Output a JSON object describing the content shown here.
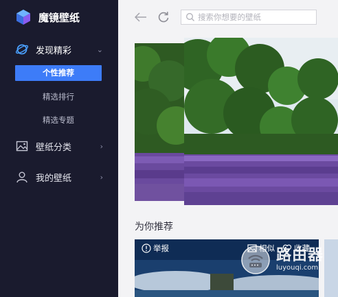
{
  "app": {
    "title": "魔镜壁纸",
    "accent": "#3d7cf8",
    "sidebar_bg": "#1a1b2e"
  },
  "sidebar": {
    "discover": {
      "label": "发现精彩",
      "icon": "planet-icon"
    },
    "sub_items": [
      "个性推荐",
      "精选排行",
      "精选专题"
    ],
    "categories": {
      "label": "壁纸分类",
      "icon": "picture-icon"
    },
    "mine": {
      "label": "我的壁纸",
      "icon": "user-icon"
    }
  },
  "toolbar": {
    "search_placeholder": "搜索你想要的壁纸"
  },
  "main": {
    "section_title": "为你推荐",
    "card": {
      "report_label": "举报",
      "similar_label": "相似",
      "favorite_label": "收藏"
    }
  },
  "watermark": {
    "title": "路由器",
    "url": "luyouqi.com"
  }
}
